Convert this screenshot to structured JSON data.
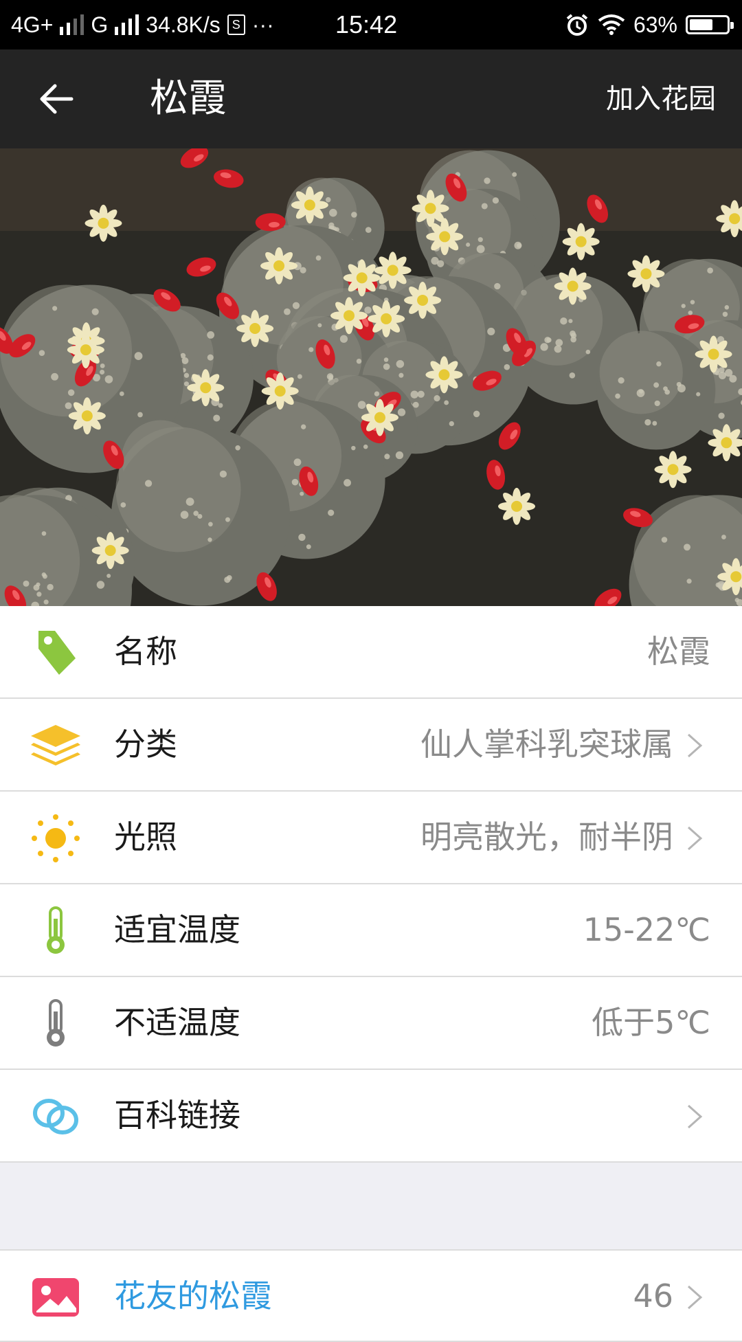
{
  "status_bar": {
    "network1": "4G+",
    "network2": "G",
    "speed": "34.8K/s",
    "sim_icon_text": "S",
    "more": "···",
    "time": "15:42",
    "battery": "63%",
    "battery_level": 0.63
  },
  "app_bar": {
    "title": "松霞",
    "add_to_garden": "加入花园"
  },
  "rows": [
    {
      "label": "名称",
      "value": "松霞",
      "icon": "tag-icon",
      "color": "#8cc63f"
    },
    {
      "label": "分类",
      "value": "仙人掌科乳突球属",
      "icon": "layers-icon",
      "color": "#f5c02b"
    },
    {
      "label": "光照",
      "value": "明亮散光，耐半阴",
      "icon": "sun-icon",
      "color": "#f5b914"
    },
    {
      "label": "适宜温度",
      "value": "15-22℃",
      "icon": "thermometer-green-icon",
      "color": "#8cc63f"
    },
    {
      "label": "不适温度",
      "value": "低于5℃",
      "icon": "thermometer-gray-icon",
      "color": "#7d7d7d"
    },
    {
      "label": "百科链接",
      "value": "",
      "icon": "link-icon",
      "color": "#5bc0e8"
    }
  ],
  "friends": {
    "label": "花友的松霞",
    "count": "46",
    "icon": "picture-icon",
    "color": "#f0466e",
    "link_color": "#2f9ae0"
  }
}
